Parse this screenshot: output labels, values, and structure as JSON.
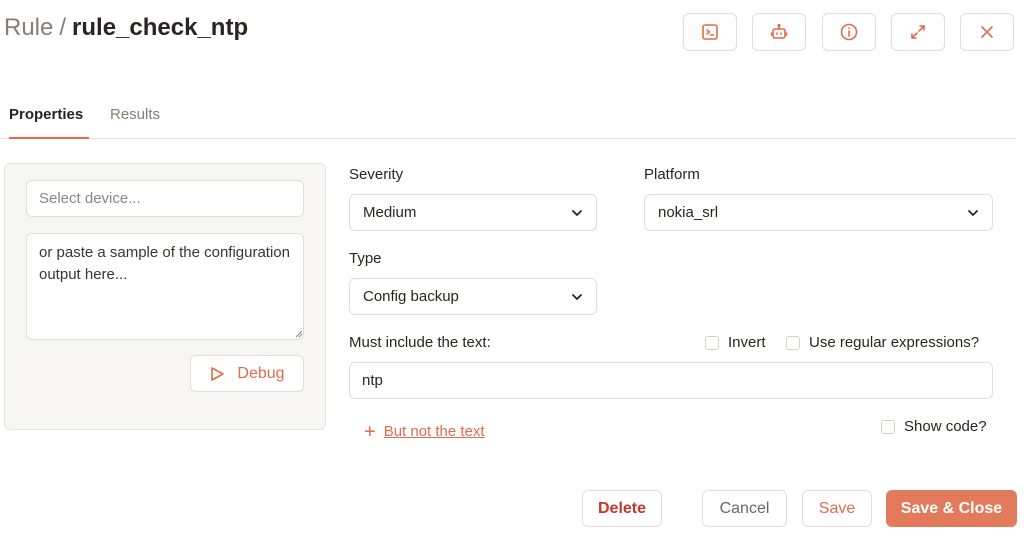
{
  "header": {
    "crumb": "Rule",
    "separator": "/",
    "name": "rule_check_ntp",
    "icons": [
      "terminal-icon",
      "robot-icon",
      "info-icon",
      "expand-icon",
      "close-icon"
    ]
  },
  "tabs": [
    {
      "label": "Properties",
      "active": true
    },
    {
      "label": "Results",
      "active": false
    }
  ],
  "debug_panel": {
    "device_placeholder": "Select device...",
    "config_placeholder": "or paste a sample of the configuration output here...",
    "debug_label": "Debug"
  },
  "form": {
    "severity": {
      "label": "Severity",
      "value": "Medium"
    },
    "platform": {
      "label": "Platform",
      "value": "nokia_srl"
    },
    "type": {
      "label": "Type",
      "value": "Config backup"
    },
    "must_include": {
      "label": "Must include the text:",
      "value": "ntp"
    },
    "invert": {
      "label": "Invert",
      "checked": false
    },
    "regex": {
      "label": "Use regular expressions?",
      "checked": false
    },
    "add_exclusion": {
      "label": "But not the text"
    },
    "show_code": {
      "label": "Show code?",
      "checked": false
    }
  },
  "footer": {
    "delete": "Delete",
    "cancel": "Cancel",
    "save": "Save",
    "save_close": "Save & Close"
  },
  "colors": {
    "accent": "#e06c4d",
    "primary_button": "#e37a5c",
    "danger": "#c2382c"
  }
}
